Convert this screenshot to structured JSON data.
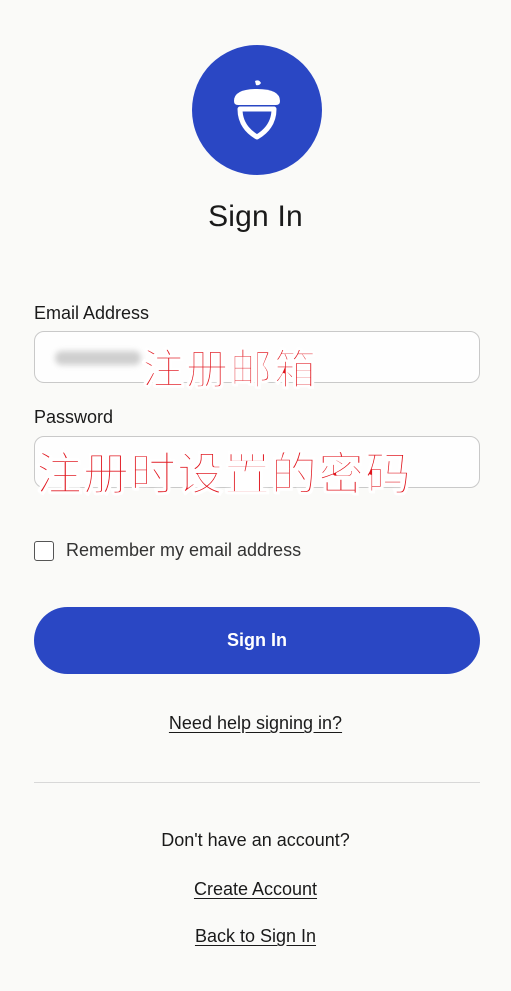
{
  "header": {
    "title": "Sign In",
    "logo_icon": "acorn-icon",
    "brand_color": "#2a47c4"
  },
  "form": {
    "email_label": "Email Address",
    "email_overlay": "注册邮箱",
    "password_label": "Password",
    "password_overlay": "注册时设置的密码",
    "remember_label": "Remember my email address",
    "remember_checked": false,
    "submit_label": "Sign In",
    "help_link": "Need help signing in?"
  },
  "footer": {
    "no_account_text": "Don't have an account?",
    "create_account_link": "Create Account",
    "back_link": "Back to Sign In"
  }
}
